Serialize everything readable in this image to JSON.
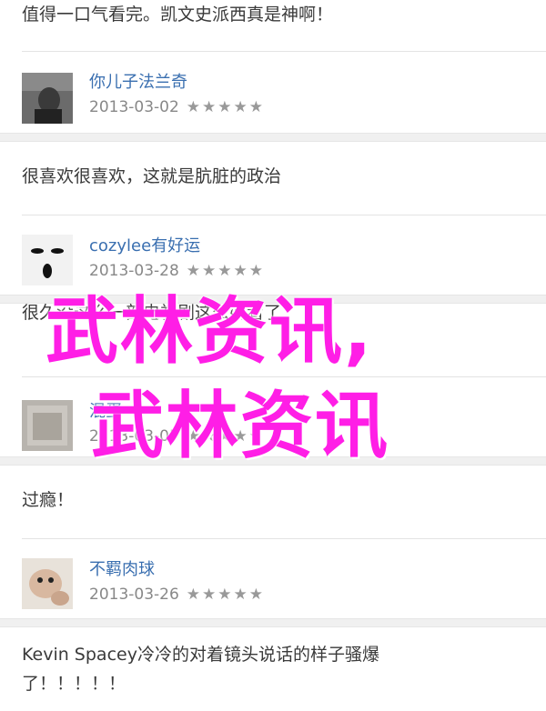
{
  "comments": [
    {
      "text": "值得一口气看完。凯文史派西真是神啊！"
    },
    {
      "user": "你儿子法兰奇",
      "date": "2013-03-02",
      "stars": "★★★★★",
      "text": "很喜欢很喜欢，这就是肮脏的政治"
    },
    {
      "user": "cozylee有好运",
      "date": "2013-03-28",
      "stars": "★★★★★",
      "text": "很久没这么一部电视剧这么好看了"
    },
    {
      "user": "混蛋",
      "date": "2013-03-05",
      "stars": "★★★★★",
      "text": "过瘾！"
    },
    {
      "user": "不羁肉球",
      "date": "2013-03-26",
      "stars": "★★★★★",
      "text": "Kevin Spacey冷冷的对着镜头说话的样子骚爆了！！！！！"
    }
  ],
  "watermark": {
    "line1": "武林资讯,",
    "line2": "武林资讯"
  }
}
